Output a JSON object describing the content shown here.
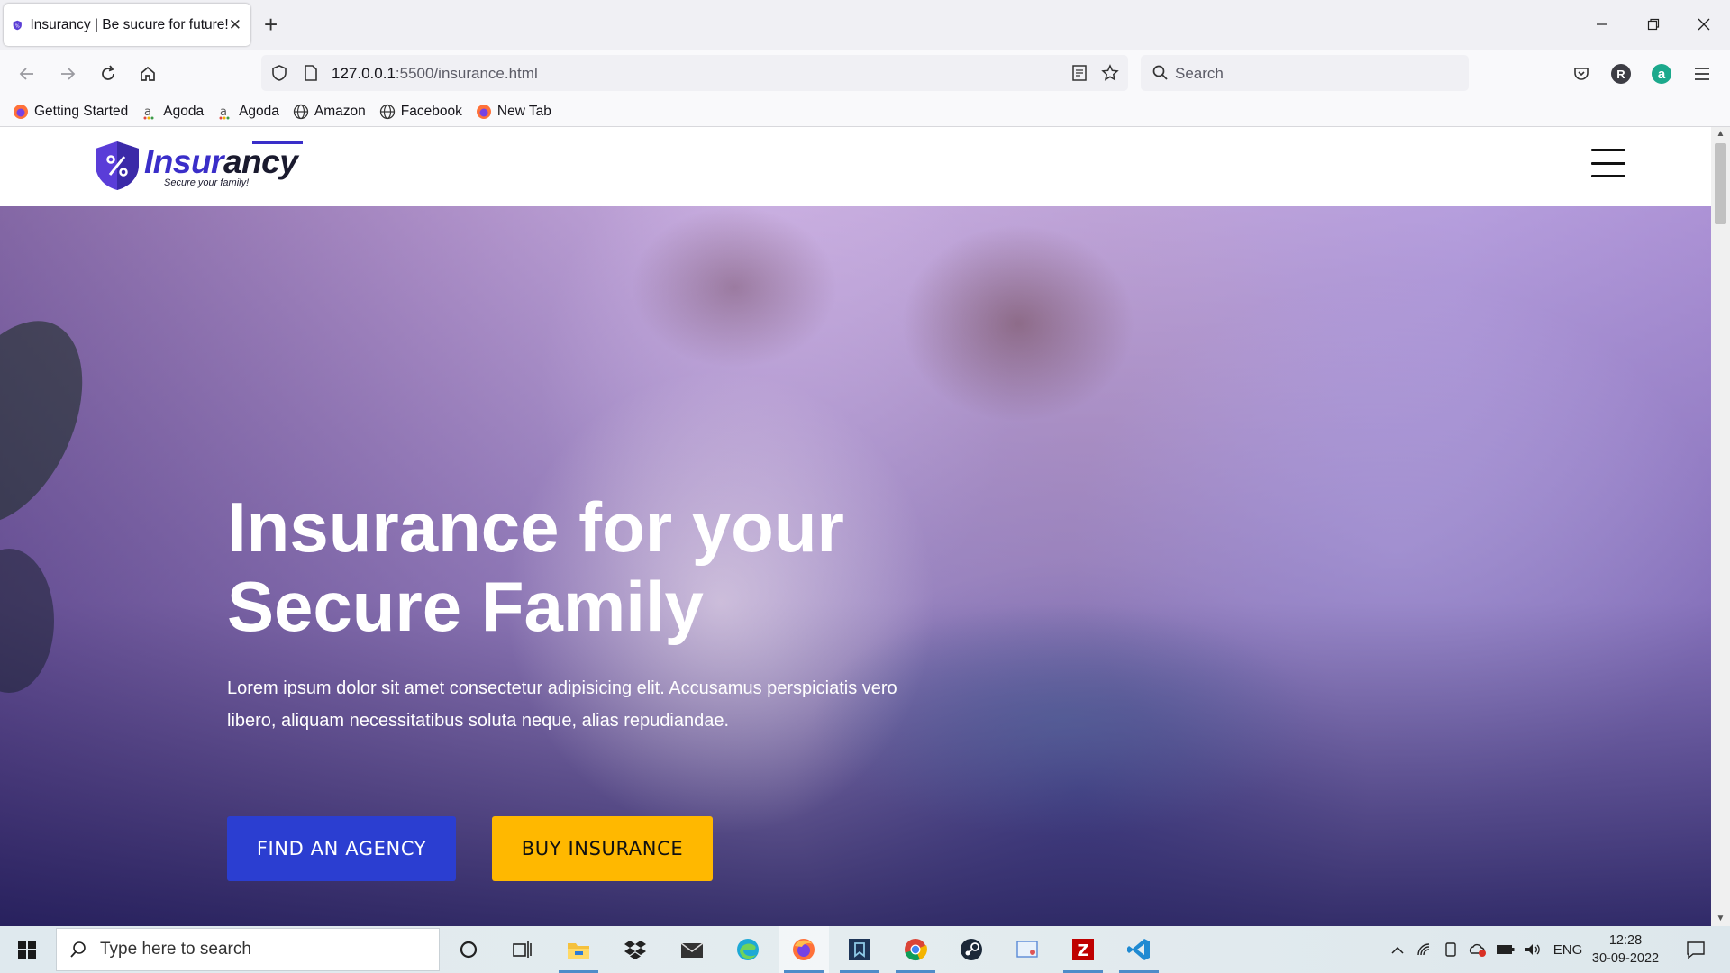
{
  "browser": {
    "tab_title": "Insurancy | Be sucure for future!",
    "url_host": "127.0.0.1",
    "url_rest": ":5500/insurance.html",
    "search_placeholder": "Search",
    "profile_initial": "R",
    "extension_initial": "a",
    "bookmarks": [
      {
        "label": "Getting Started",
        "icon": "firefox-icon"
      },
      {
        "label": "Agoda",
        "icon": "agoda-icon"
      },
      {
        "label": "Agoda",
        "icon": "agoda-icon"
      },
      {
        "label": "Amazon",
        "icon": "globe-icon"
      },
      {
        "label": "Facebook",
        "icon": "globe-icon"
      },
      {
        "label": "New Tab",
        "icon": "firefox-icon"
      }
    ]
  },
  "site": {
    "logo_name_a": "Insur",
    "logo_name_b": "ancy",
    "logo_tagline": "Secure your family!",
    "hero": {
      "title_line1": "Insurance for your",
      "title_line2": "Secure Family",
      "description": "Lorem ipsum dolor sit amet consectetur adipisicing elit. Accusamus perspiciatis vero libero, aliquam necessitatibus soluta neque, alias repudiandae.",
      "btn_agency": "FIND AN AGENCY",
      "btn_buy": "BUY INSURANCE"
    },
    "colors": {
      "primary": "#2b3ed1",
      "accent": "#ffb800",
      "logo_purple": "#3a2ec9"
    }
  },
  "taskbar": {
    "search_placeholder": "Type here to search",
    "language": "ENG",
    "time": "12:28",
    "date": "30-09-2022",
    "apps": [
      "cortana-icon",
      "task-view-icon",
      "file-explorer-icon",
      "dropbox-icon",
      "mail-icon",
      "edge-icon",
      "firefox-icon",
      "kindle-icon",
      "chrome-icon",
      "steam-icon",
      "snipping-tool-icon",
      "filezilla-icon",
      "vscode-icon"
    ]
  }
}
